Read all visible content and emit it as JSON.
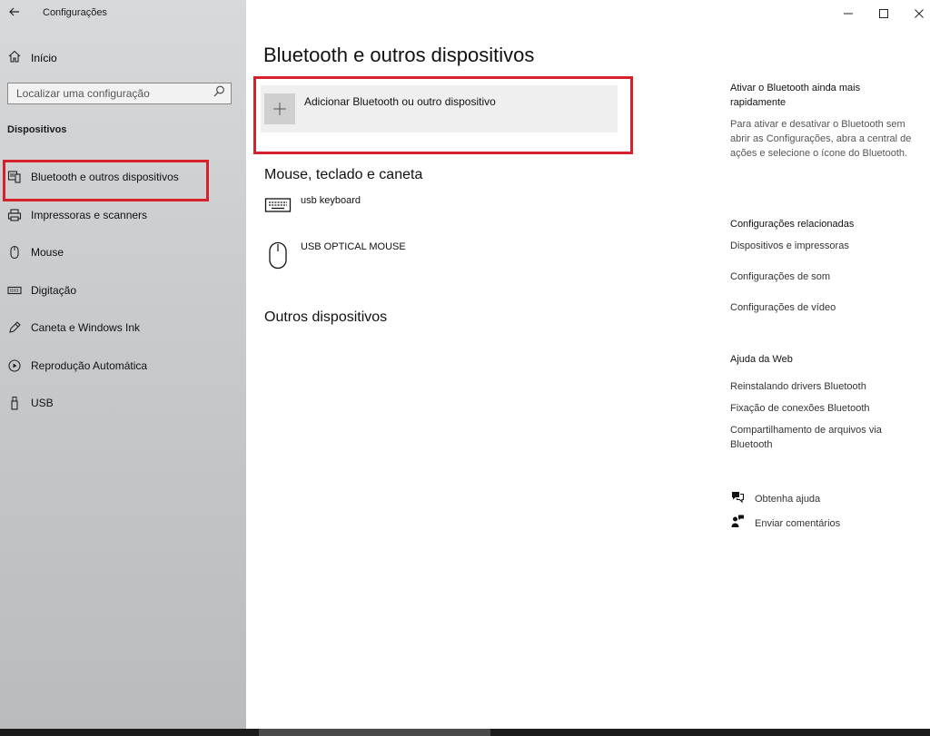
{
  "window": {
    "title": "Configurações"
  },
  "sidebar": {
    "home_label": "Início",
    "search_placeholder": "Localizar uma configuração",
    "section_title": "Dispositivos",
    "items": [
      {
        "label": "Bluetooth e outros dispositivos",
        "icon": "bluetooth-devices-icon"
      },
      {
        "label": "Impressoras e scanners",
        "icon": "printer-icon"
      },
      {
        "label": "Mouse",
        "icon": "mouse-icon"
      },
      {
        "label": "Digitação",
        "icon": "keyboard-icon"
      },
      {
        "label": "Caneta e Windows Ink",
        "icon": "pen-icon"
      },
      {
        "label": "Reprodução Automática",
        "icon": "autoplay-icon"
      },
      {
        "label": "USB",
        "icon": "usb-icon"
      }
    ]
  },
  "main": {
    "title": "Bluetooth e outros dispositivos",
    "add_device_label": "Adicionar Bluetooth ou outro dispositivo",
    "mouse_section_title": "Mouse, teclado e caneta",
    "devices": [
      {
        "name": "usb keyboard",
        "icon": "keyboard-icon"
      },
      {
        "name": "USB OPTICAL MOUSE",
        "icon": "mouse-icon"
      }
    ],
    "other_section_title": "Outros dispositivos"
  },
  "right_panel": {
    "quick_title": "Ativar o Bluetooth ainda mais rapidamente",
    "quick_text": "Para ativar e desativar o Bluetooth sem abrir as Configurações, abra a central de ações e selecione o ícone do Bluetooth.",
    "related_title": "Configurações relacionadas",
    "related_links": [
      "Dispositivos e impressoras",
      "Configurações de som",
      "Configurações de vídeo"
    ],
    "web_help_title": "Ajuda da Web",
    "web_links": [
      "Reinstalando drivers Bluetooth",
      "Fixação de conexões Bluetooth",
      "Compartilhamento de arquivos via Bluetooth"
    ],
    "get_help": "Obtenha ajuda",
    "feedback": "Enviar comentários"
  },
  "colors": {
    "highlight": "#d6202a",
    "sidebar_bg": "#c9cbcd"
  }
}
